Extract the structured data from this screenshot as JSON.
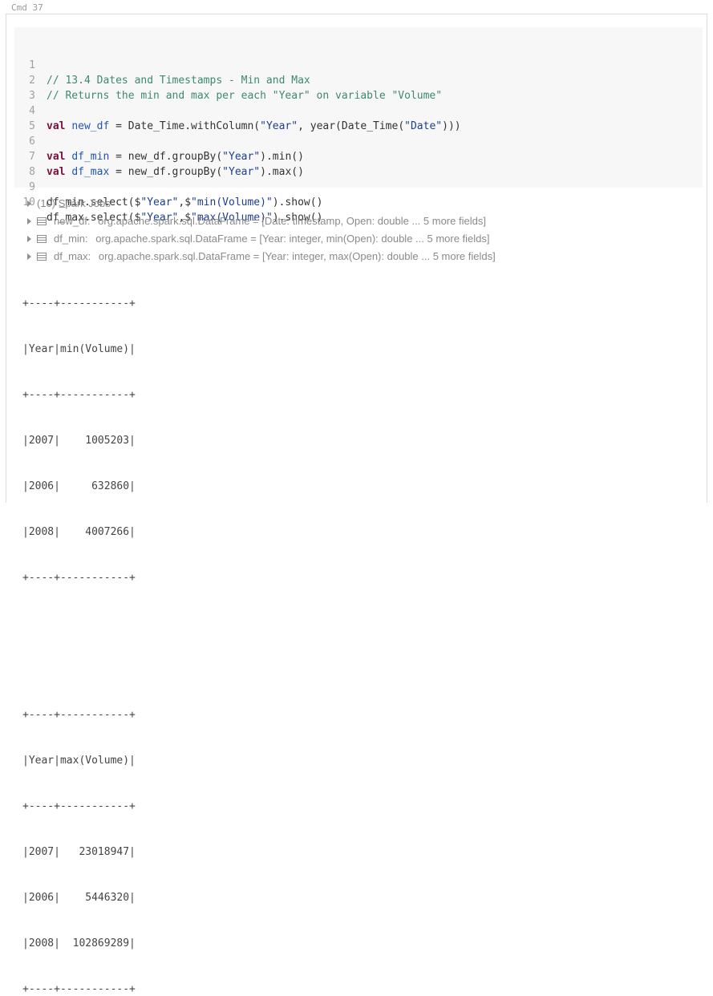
{
  "cmd_label": "Cmd 37",
  "code": {
    "line_numbers": [
      "1",
      "2",
      "3",
      "4",
      "5",
      "6",
      "7",
      "8",
      "9",
      "10"
    ],
    "line1": "// 13.4 Dates and Timestamps - Min and Max",
    "line2": "// Returns the min and max per each \"Year\" on variable \"Volume\"",
    "line4": {
      "kw": "val",
      "var": "new_df",
      "p1": " = Date_Time.withColumn(",
      "s1": "\"Year\"",
      "p2": ", year(Date_Time(",
      "s2": "\"Date\"",
      "p3": ")))"
    },
    "line6": {
      "kw": "val",
      "var": "df_min",
      "p1": " = new_df.groupBy(",
      "s1": "\"Year\"",
      "p2": ").min()"
    },
    "line7": {
      "kw": "val",
      "var": "df_max",
      "p1": " = new_df.groupBy(",
      "s1": "\"Year\"",
      "p2": ").max()"
    },
    "line9": {
      "p1": "df_min.select($",
      "s1": "\"Year\"",
      "p2": ",$",
      "s2": "\"min(Volume)\"",
      "p3": ").show()"
    },
    "line10": {
      "p1": "df_max.select($",
      "s1": "\"Year\"",
      "p2": ",$",
      "s2": "\"max(Volume)\"",
      "p3": ").show()"
    }
  },
  "output": {
    "spark_jobs": "(10) Spark Jobs",
    "dataframes": [
      {
        "name": "new_df:",
        "type": "org.apache.spark.sql.DataFrame = [Date: timestamp, Open: double ... 5 more fields]"
      },
      {
        "name": "df_min:",
        "type": "org.apache.spark.sql.DataFrame = [Year: integer, min(Open): double ... 5 more fields]"
      },
      {
        "name": "df_max:",
        "type": "org.apache.spark.sql.DataFrame = [Year: integer, max(Open): double ... 5 more fields]"
      }
    ],
    "console": [
      "+----+-----------+",
      "|Year|min(Volume)|",
      "+----+-----------+",
      "|2007|    1005203|",
      "|2006|     632860|",
      "|2008|    4007266|",
      "+----+-----------+",
      "",
      "",
      "+----+-----------+",
      "|Year|max(Volume)|",
      "+----+-----------+",
      "|2007|   23018947|",
      "|2006|    5446320|",
      "|2008|  102869289|",
      "+----+-----------+"
    ]
  }
}
